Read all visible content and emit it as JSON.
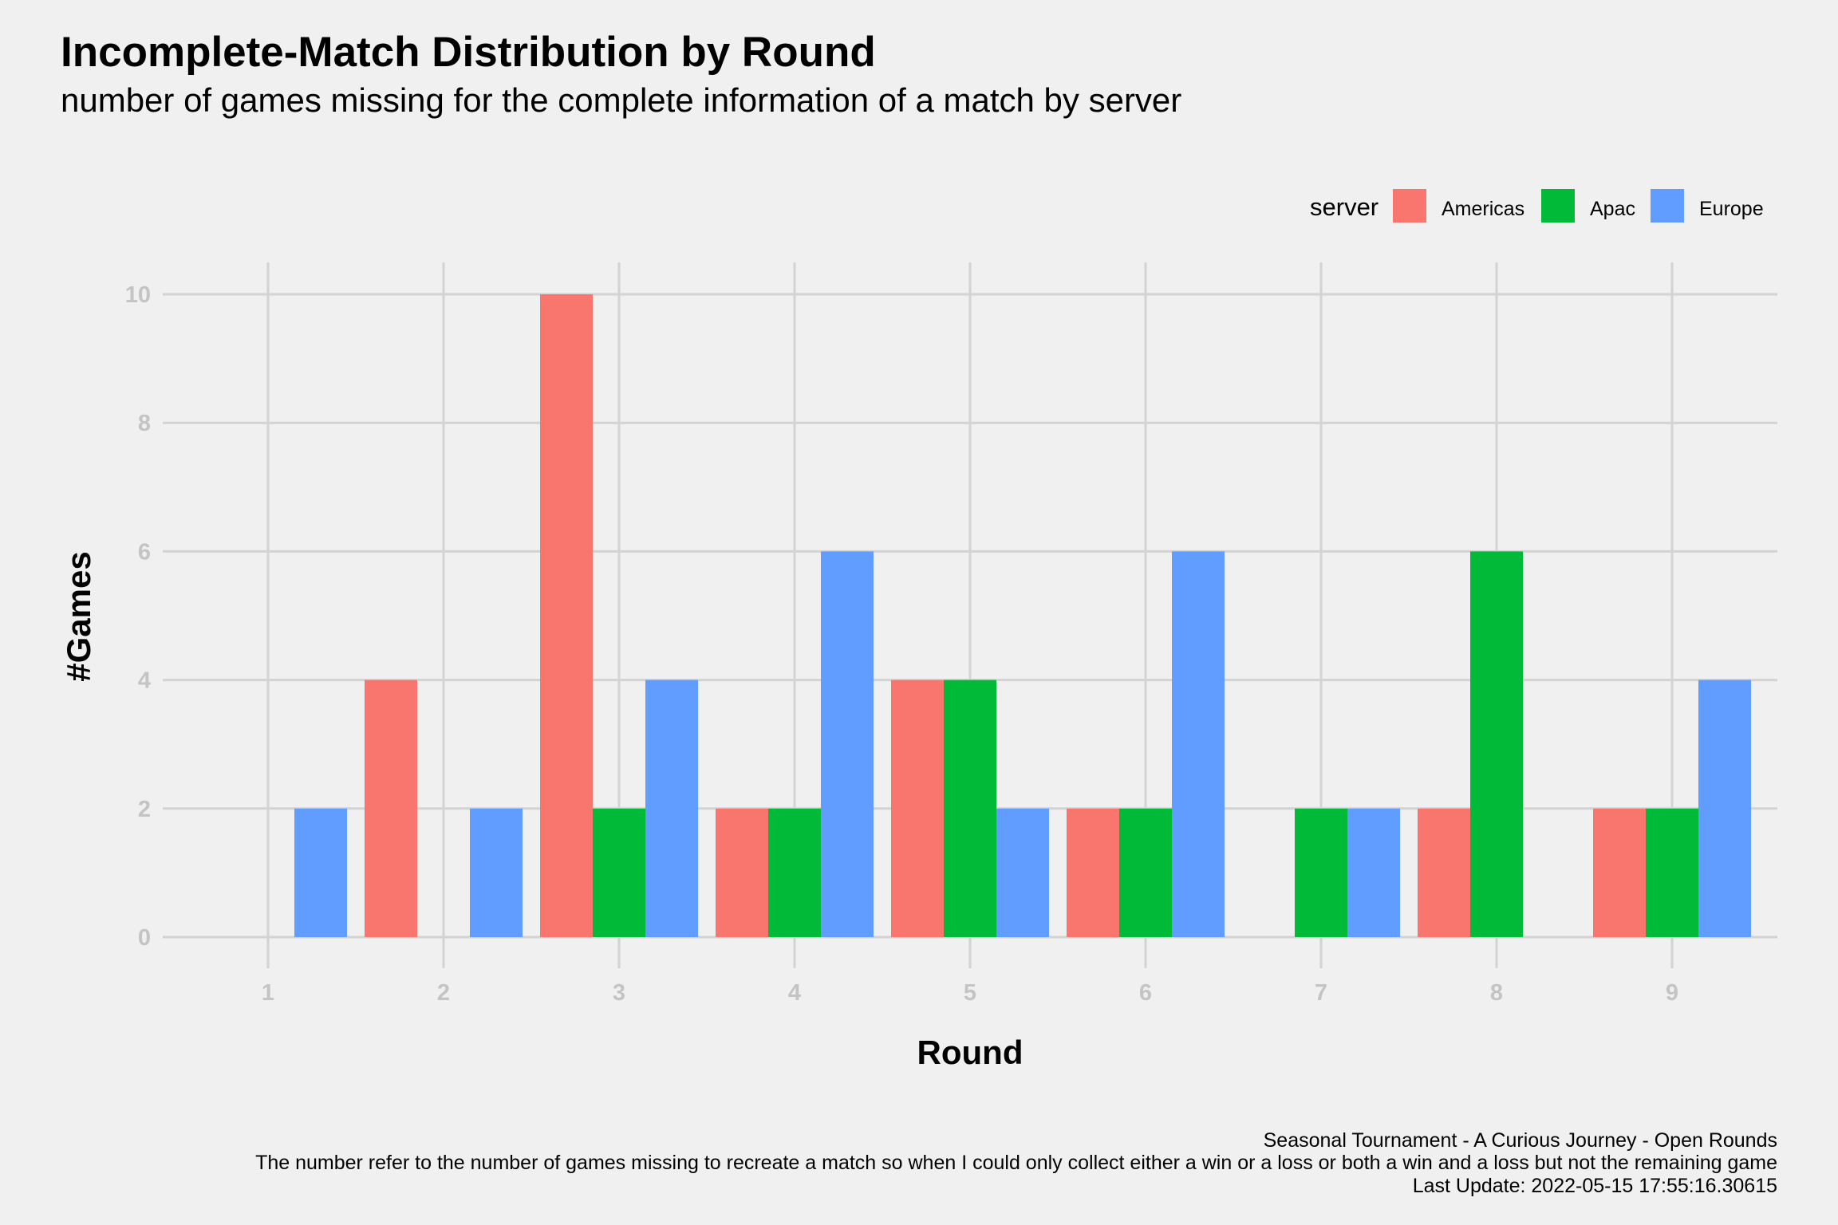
{
  "chart_data": {
    "type": "bar",
    "title": "Incomplete-Match Distribution by Round",
    "subtitle": "number of games missing for the complete information of a match by server",
    "xlabel": "Round",
    "ylabel": "#Games",
    "categories": [
      "1",
      "2",
      "3",
      "4",
      "5",
      "6",
      "7",
      "8",
      "9"
    ],
    "y_ticks": [
      "0",
      "2",
      "4",
      "6",
      "8",
      "10"
    ],
    "y_tick_values": [
      0,
      2,
      4,
      6,
      8,
      10
    ],
    "ylim": [
      0,
      10.5
    ],
    "grid": true,
    "legend": {
      "title": "server",
      "placement": "top-right",
      "entries": [
        "Americas",
        "Apac",
        "Europe"
      ]
    },
    "series": [
      {
        "name": "Americas",
        "color": "#F8766D",
        "values": [
          null,
          4,
          10,
          2,
          4,
          2,
          null,
          2,
          2
        ]
      },
      {
        "name": "Apac",
        "color": "#00BA38",
        "values": [
          null,
          null,
          2,
          2,
          4,
          2,
          2,
          6,
          2
        ]
      },
      {
        "name": "Europe",
        "color": "#619CFF",
        "values": [
          2,
          2,
          4,
          6,
          2,
          6,
          2,
          null,
          4
        ]
      }
    ],
    "caption": [
      "Seasonal Tournament - A Curious Journey - Open Rounds",
      "The number refer to the number of games missing to recreate a match so when I could only collect either a win or a loss or both a win and a loss but not the remaining game",
      "Last Update: 2022-05-15 17:55:16.30615"
    ]
  },
  "colors": {
    "background": "#f0f0f0",
    "gridline": "#d3d3d3",
    "tick_text": "#c4c4c4"
  }
}
